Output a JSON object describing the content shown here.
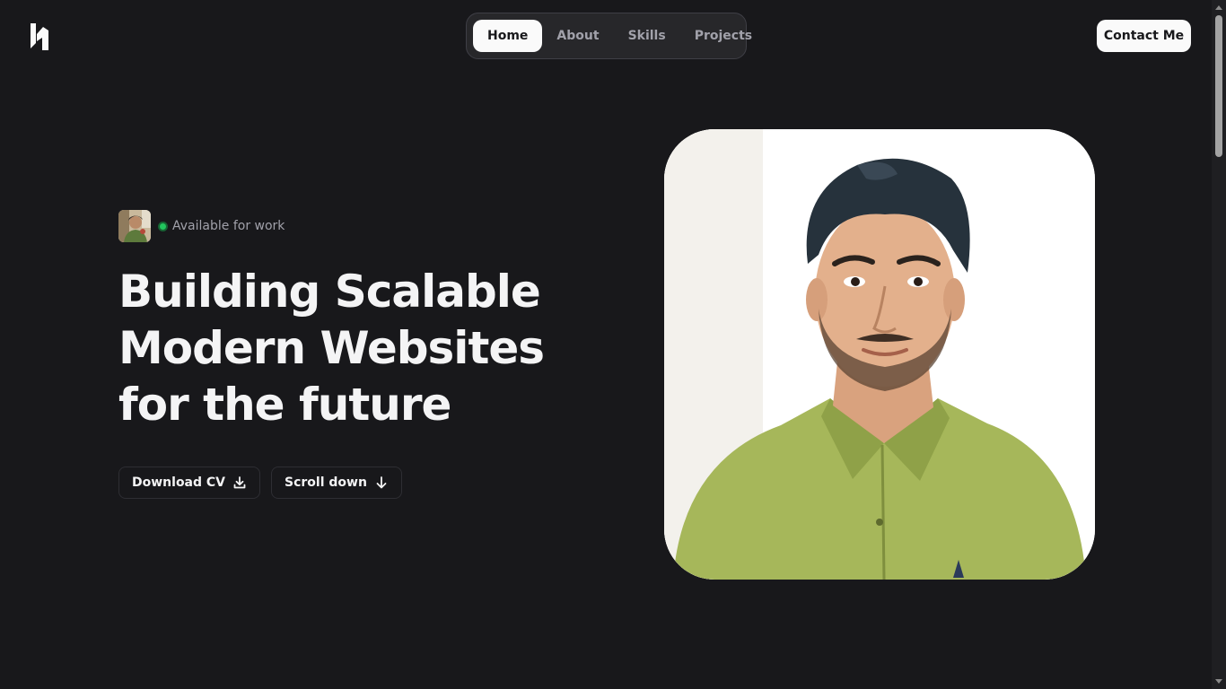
{
  "header": {
    "logo_icon": "brand-logo-icon",
    "nav": [
      {
        "label": "Home",
        "active": true
      },
      {
        "label": "About",
        "active": false
      },
      {
        "label": "Skills",
        "active": false
      },
      {
        "label": "Projects",
        "active": false
      }
    ],
    "contact_label": "Contact Me"
  },
  "hero": {
    "status_text": "Available for work",
    "status_color": "#22c55e",
    "headline_lines": [
      "Building Scalable",
      "Modern Websites",
      "for the future"
    ],
    "buttons": [
      {
        "label": "Download CV",
        "icon": "download-icon"
      },
      {
        "label": "Scroll down",
        "icon": "arrow-down-icon"
      }
    ]
  },
  "colors": {
    "background": "#18181b",
    "nav_background": "#27272a",
    "primary_button": "#fafafa",
    "muted_text": "#a1a1aa"
  }
}
